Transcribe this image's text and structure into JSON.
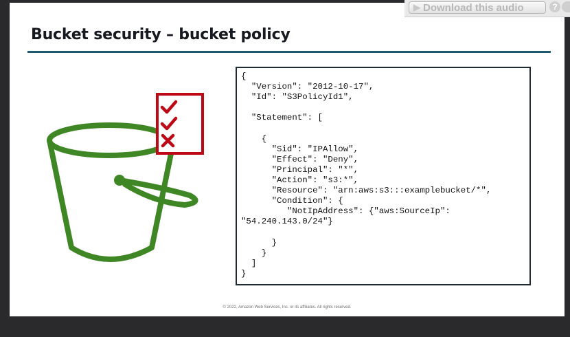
{
  "slide": {
    "title": "Bucket security – bucket policy",
    "copyright": "© 2022, Amazon Web Services, Inc. or its affiliates. All rights reserved.",
    "code": "{\n  \"Version\": \"2012-10-17\",\n  \"Id\": \"S3PolicyId1\",\n\n  \"Statement\": [\n\n    {\n      \"Sid\": \"IPAllow\",\n      \"Effect\": \"Deny\",\n      \"Principal\": \"*\",\n      \"Action\": \"s3:*\",\n      \"Resource\": \"arn:aws:s3:::examplebucket/*\",\n      \"Condition\": {\n         \"NotIpAddress\": {\"aws:SourceIp\":\n\"54.240.143.0/24\"}\n\n      }\n    }\n  ]\n}"
  },
  "audio_bar": {
    "download_label": "Download this audio",
    "help_label": "?"
  },
  "colors": {
    "bucket_green": "#3f8624",
    "checklist_red": "#bf0816",
    "title_rule": "#1f5a6e"
  },
  "icons": {
    "bucket": "s3-bucket-icon",
    "checklist": "checklist-icon",
    "play": "play-icon"
  }
}
